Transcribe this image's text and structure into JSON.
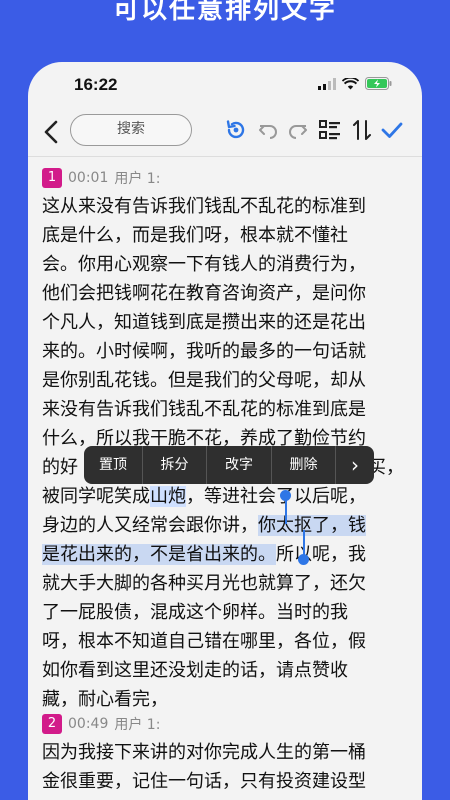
{
  "banner": {
    "title": "可以任意排列文字"
  },
  "status_bar": {
    "time": "16:22"
  },
  "toolbar": {
    "search_placeholder": "搜索"
  },
  "context_menu": {
    "items": [
      "置顶",
      "拆分",
      "改字",
      "删除"
    ],
    "more": "›"
  },
  "segments": [
    {
      "index": "1",
      "time": "00:01",
      "speaker": "用户 1:",
      "lines": [
        "这从来没有告诉我们钱乱不乱花的标准到",
        "底是什么，而是我们呀，根本就不懂社",
        "会。你用心观察一下有钱人的消费行为，",
        "他们会把钱啊花在教育咨询资产，是问你",
        "个凡人，知道钱到底是攒出来的还是花出",
        "来的。小时候啊，我听的最多的一句话就",
        "是你别乱花钱。但是我们的父母呢，却从",
        "来没有告诉我们钱乱不乱花的标准到底是",
        "什么，所以我干脆不花，养成了勤俭节约",
        "的好",
        "被同学呢笑成山炮，等进社会了以后呢，",
        "身边的人又经常会跟你讲，你太抠了，钱",
        "是花出来的，不是省出来的。所以呢，我",
        "就大手大脚的各种买月光也就算了，还欠",
        "了一屁股债，混成这个卵样。当时的我",
        "呀，根本不知道自己错在哪里，各位，假",
        "如你看到这里还没划走的话，请点赞收",
        "藏，耐心看完，"
      ],
      "line9_tail": "买，",
      "line11_a": "身边的人又经常会跟你讲，",
      "line11_b": "你太抠了，钱",
      "line12_a": "是花出来的，不是省出来的。",
      "line12_b": "所以呢，我",
      "line10_a": "被同学呢笑成",
      "line10_b": "山炮",
      "line10_c": "，等进社会了以后呢，"
    },
    {
      "index": "2",
      "time": "00:49",
      "speaker": "用户 1:",
      "lines": [
        "因为我接下来讲的对你完成人生的第一桶",
        "金很重要，记住一句话，只有投资建设型"
      ]
    }
  ]
}
